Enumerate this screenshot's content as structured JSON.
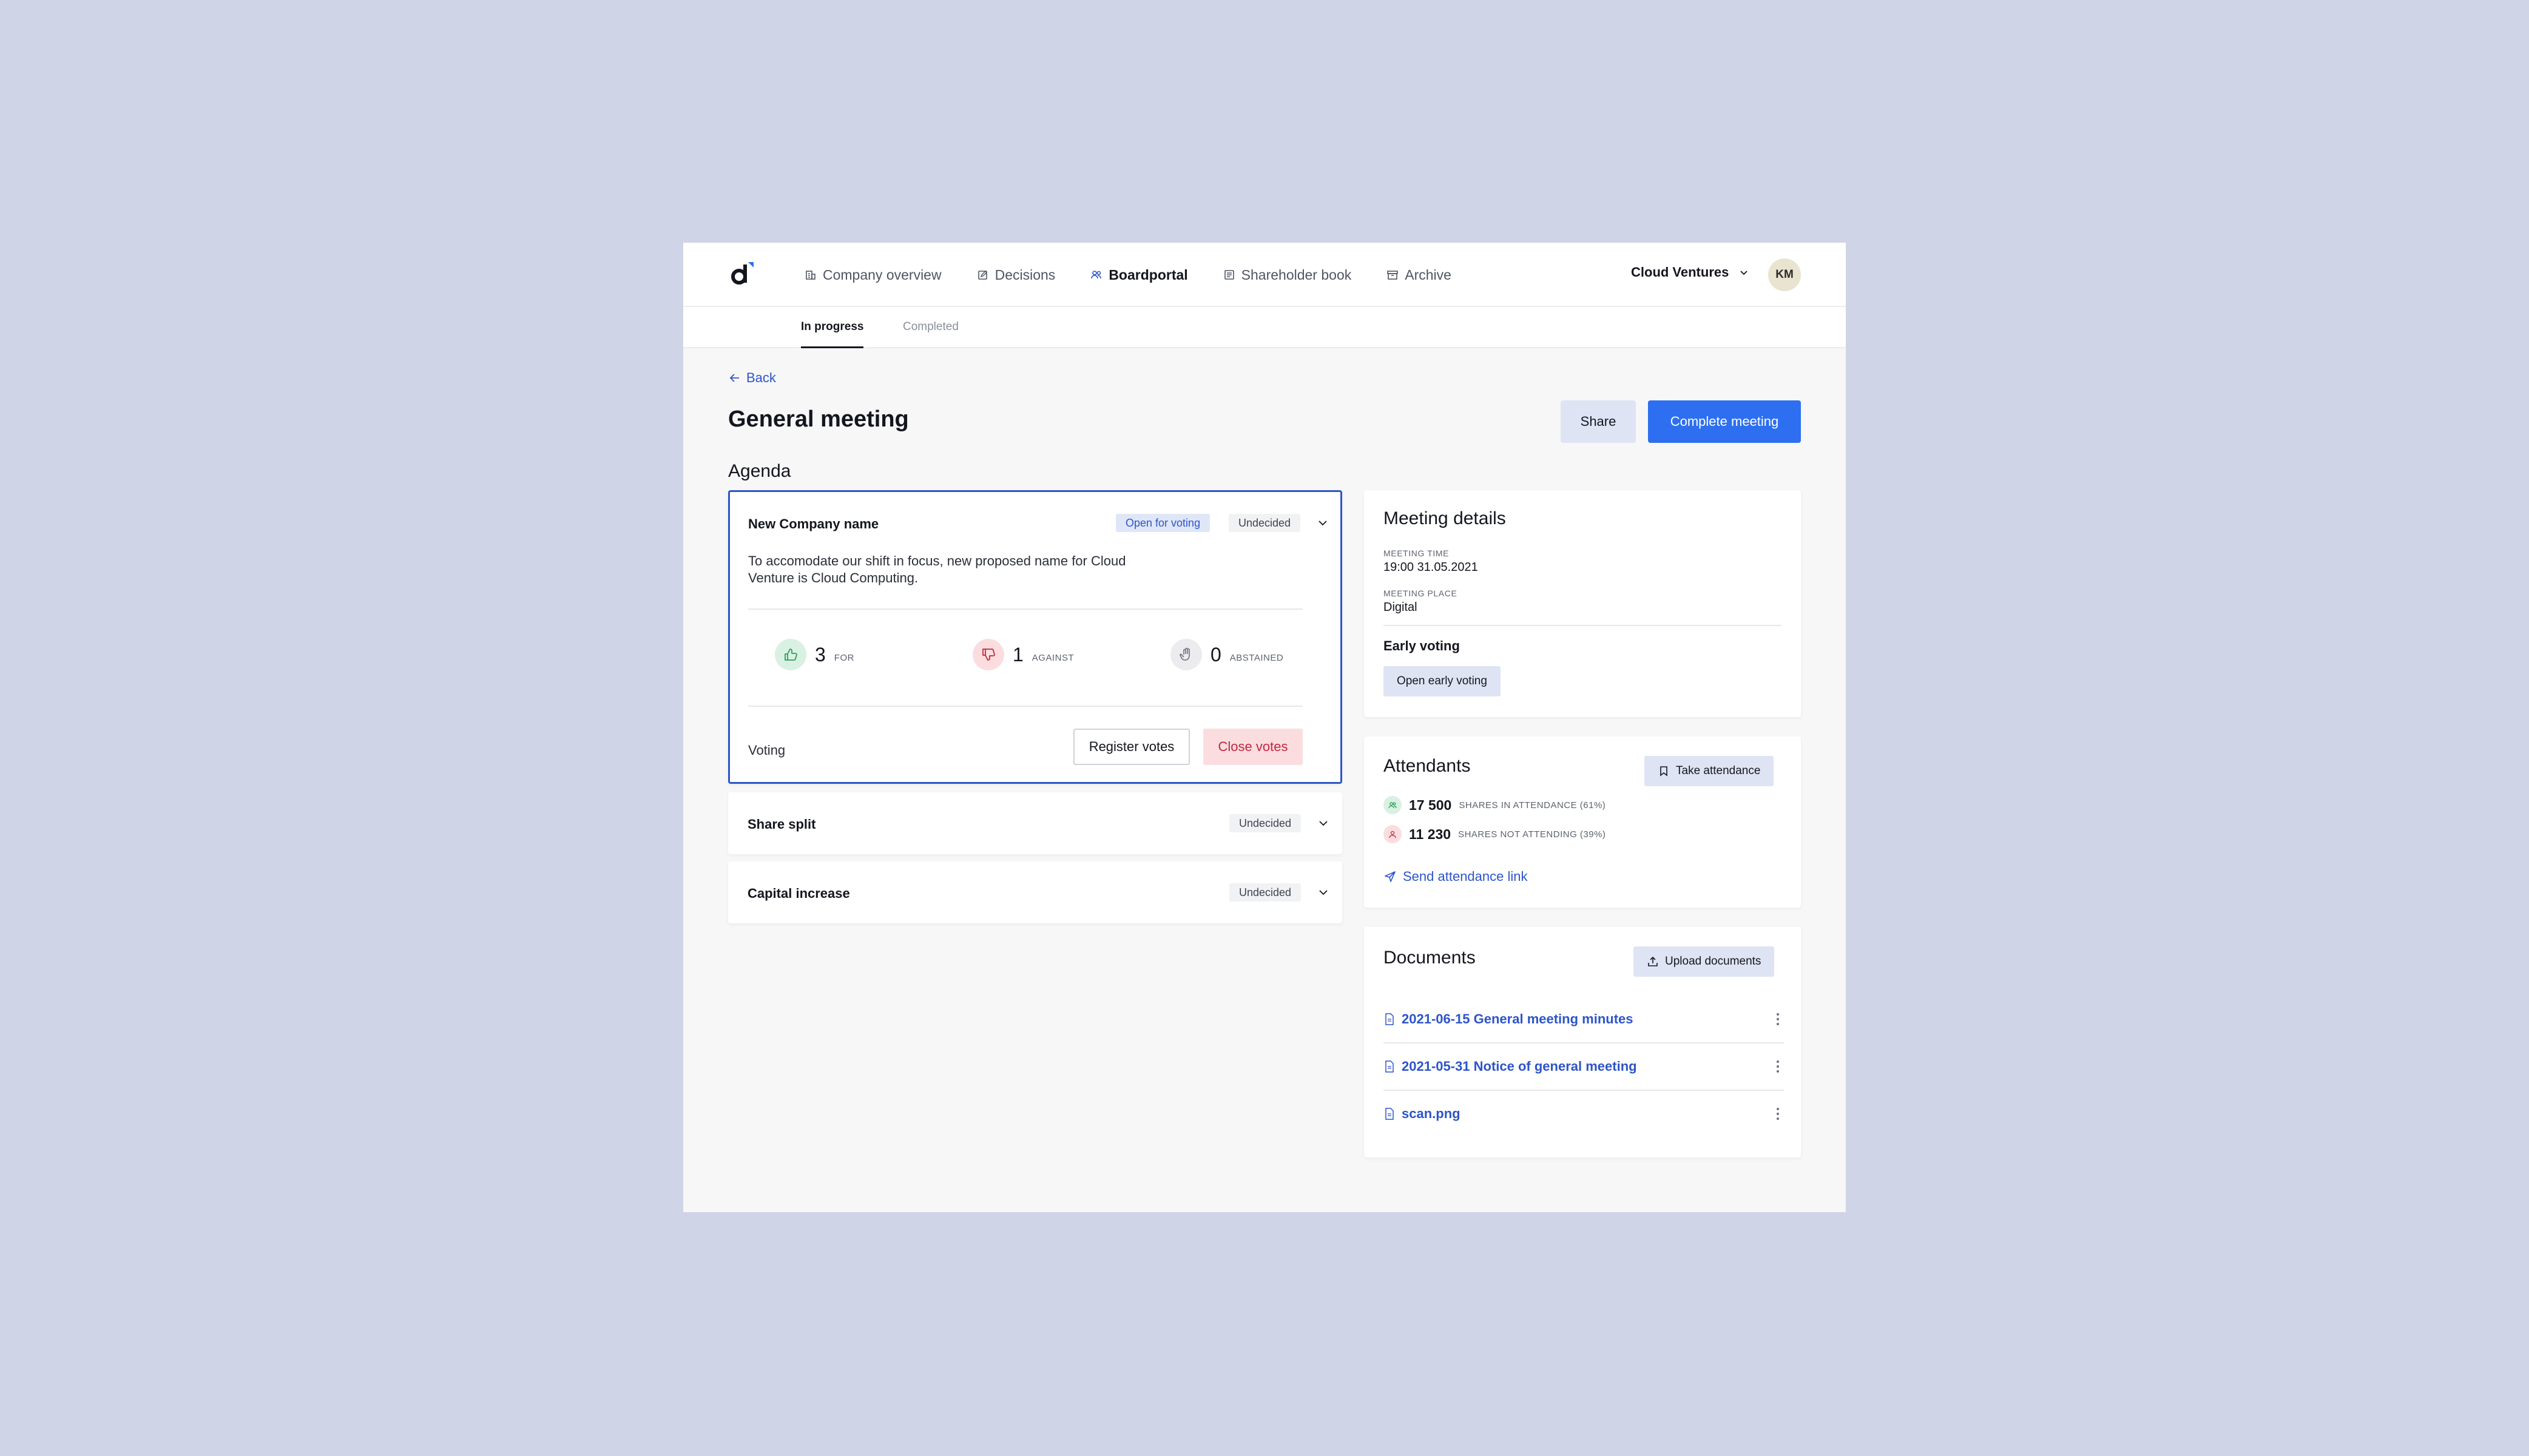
{
  "nav": {
    "items": [
      {
        "label": "Company overview",
        "icon": "building-icon"
      },
      {
        "label": "Decisions",
        "icon": "edit-icon"
      },
      {
        "label": "Boardportal",
        "icon": "users-icon"
      },
      {
        "label": "Shareholder book",
        "icon": "book-icon"
      },
      {
        "label": "Archive",
        "icon": "archive-icon"
      }
    ],
    "active": "Boardportal",
    "company": "Cloud Ventures",
    "avatar_initials": "KM"
  },
  "subnav": {
    "tabs": [
      {
        "label": "In progress"
      },
      {
        "label": "Completed"
      }
    ],
    "active": "In progress"
  },
  "header": {
    "back_label": "Back",
    "title": "General meeting",
    "share_label": "Share",
    "complete_label": "Complete meeting"
  },
  "agenda": {
    "heading": "Agenda",
    "items": [
      {
        "title": "New Company name",
        "status_open": "Open for voting",
        "status": "Undecided",
        "description": "To accomodate our shift in focus, new proposed name for Cloud Venture is Cloud Computing.",
        "votes": {
          "for": {
            "count": "3",
            "label": "FOR"
          },
          "against": {
            "count": "1",
            "label": "AGAINST"
          },
          "abstained": {
            "count": "0",
            "label": "ABSTAINED"
          }
        },
        "voting_label": "Voting",
        "register_label": "Register votes",
        "close_label": "Close votes"
      },
      {
        "title": "Share split",
        "status": "Undecided"
      },
      {
        "title": "Capital increase",
        "status": "Undecided"
      }
    ]
  },
  "meeting_details": {
    "title": "Meeting details",
    "time_label": "MEETING TIME",
    "time_value": "19:00 31.05.2021",
    "place_label": "MEETING PLACE",
    "place_value": "Digital",
    "early_voting_title": "Early voting",
    "early_voting_button": "Open early voting"
  },
  "attendants": {
    "title": "Attendants",
    "take_attendance": "Take attendance",
    "attending": {
      "count": "17 500",
      "label": "SHARES IN ATTENDANCE (61%)"
    },
    "not_attending": {
      "count": "11 230",
      "label": "SHARES NOT ATTENDING (39%)"
    },
    "send_link": "Send attendance link"
  },
  "documents": {
    "title": "Documents",
    "upload_label": "Upload documents",
    "files": [
      {
        "name": "2021-06-15 General meeting minutes"
      },
      {
        "name": "2021-05-31 Notice of general meeting"
      },
      {
        "name": "scan.png"
      }
    ]
  },
  "colors": {
    "accent": "#2d6ff0",
    "link": "#2d55c8",
    "backdrop": "#cfd4e6",
    "danger": "#c2283d",
    "success": "#2e9e5b"
  }
}
